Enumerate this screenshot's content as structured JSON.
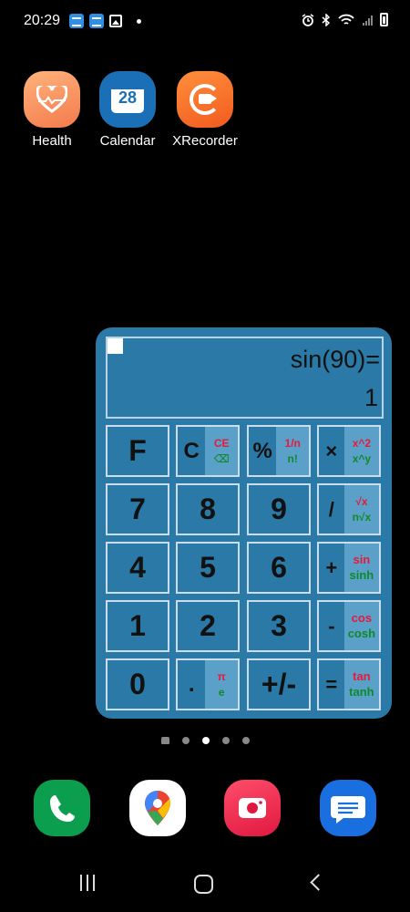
{
  "status_bar": {
    "time": "20:29",
    "left_icons": [
      "news-notification-icon",
      "news-notification-icon",
      "gallery-icon",
      "dot-icon"
    ],
    "right_icons": [
      "alarm-icon",
      "bluetooth-icon",
      "wifi-icon",
      "signal-icon",
      "battery-icon"
    ]
  },
  "home_apps": [
    {
      "name": "health",
      "label": "Health",
      "icon": "health-heart-icon"
    },
    {
      "name": "calendar",
      "label": "Calendar",
      "icon": "calendar-icon",
      "icon_text": "28"
    },
    {
      "name": "xrecorder",
      "label": "XRecorder",
      "icon": "screen-recorder-icon"
    }
  ],
  "calculator": {
    "expression": "sin(90)=",
    "result": "1",
    "keys": [
      {
        "id": "f",
        "main": "F"
      },
      {
        "id": "c",
        "main": "C",
        "top": "CE",
        "bottom": "⌫"
      },
      {
        "id": "percent",
        "main": "%",
        "top": "1/n",
        "bottom": "n!"
      },
      {
        "id": "multiply",
        "main": "×",
        "top": "x^2",
        "bottom": "x^y"
      },
      {
        "id": "7",
        "main": "7"
      },
      {
        "id": "8",
        "main": "8"
      },
      {
        "id": "9",
        "main": "9"
      },
      {
        "id": "divide",
        "main": "/",
        "top": "√x",
        "bottom": "n√x"
      },
      {
        "id": "4",
        "main": "4"
      },
      {
        "id": "5",
        "main": "5"
      },
      {
        "id": "6",
        "main": "6"
      },
      {
        "id": "plus",
        "main": "+",
        "top": "sin",
        "bottom": "sinh"
      },
      {
        "id": "1",
        "main": "1"
      },
      {
        "id": "2",
        "main": "2"
      },
      {
        "id": "3",
        "main": "3"
      },
      {
        "id": "minus",
        "main": "-",
        "top": "cos",
        "bottom": "cosh"
      },
      {
        "id": "0",
        "main": "0"
      },
      {
        "id": "dot",
        "main": ".",
        "top": "π",
        "bottom": "e"
      },
      {
        "id": "sign",
        "main": "+/-"
      },
      {
        "id": "equals",
        "main": "=",
        "top": "tan",
        "bottom": "tanh"
      }
    ]
  },
  "page_indicator": {
    "count": 5,
    "active": 2
  },
  "dock": [
    {
      "name": "phone",
      "icon": "phone-icon"
    },
    {
      "name": "maps",
      "icon": "maps-pin-icon"
    },
    {
      "name": "camera",
      "icon": "camera-icon"
    },
    {
      "name": "messages",
      "icon": "messages-icon"
    }
  ],
  "nav": [
    "recent-apps-icon",
    "home-icon",
    "back-icon"
  ],
  "colors": {
    "widget_bg": "#2b79a6",
    "side_panel": "#5aa0c9",
    "accent_red": "#e41b3c",
    "accent_green": "#0f8a2a"
  }
}
